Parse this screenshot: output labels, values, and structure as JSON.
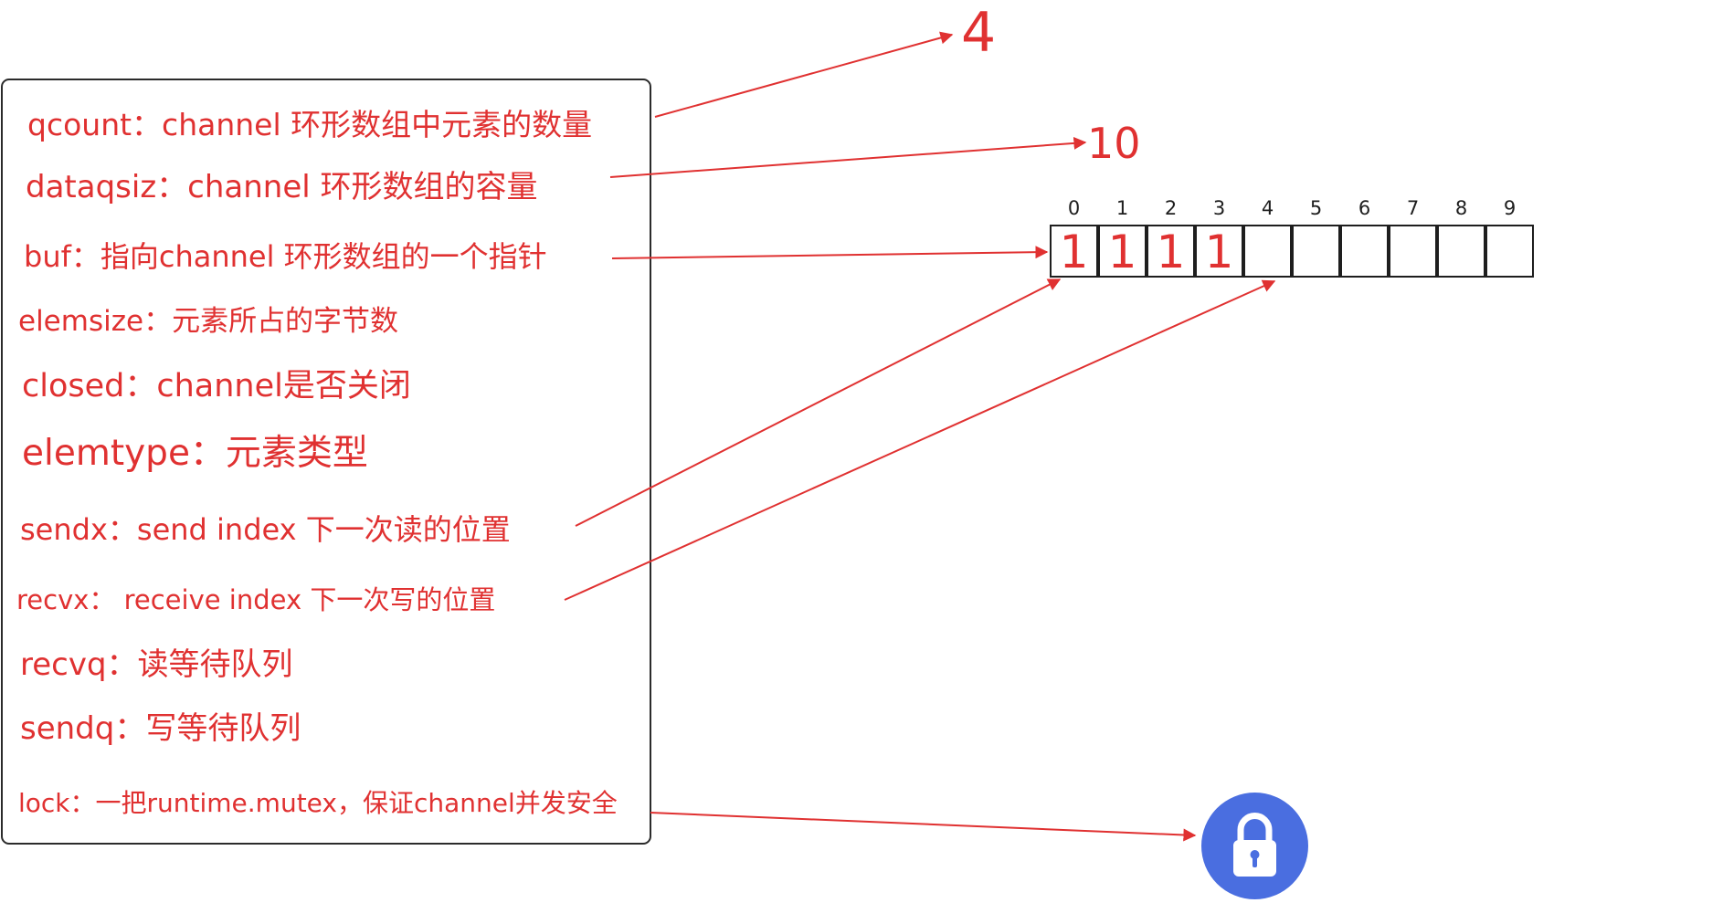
{
  "fields": [
    {
      "key": "qcount",
      "label": "qcount：channel 环形数组中元素的数量"
    },
    {
      "key": "dataqsiz",
      "label": "dataqsiz：channel 环形数组的容量"
    },
    {
      "key": "buf",
      "label": "buf：指向channel 环形数组的一个指针"
    },
    {
      "key": "elemsize",
      "label": "elemsize：元素所占的字节数"
    },
    {
      "key": "closed",
      "label": "closed：channel是否关闭"
    },
    {
      "key": "elemtype",
      "label": "elemtype：元素类型"
    },
    {
      "key": "sendx",
      "label": "sendx：send index 下一次读的位置"
    },
    {
      "key": "recvx",
      "label": "recvx：  receive index 下一次写的位置"
    },
    {
      "key": "recvq",
      "label": "recvq：读等待队列"
    },
    {
      "key": "sendq",
      "label": "sendq：写等待队列"
    },
    {
      "key": "lock",
      "label": "lock：一把runtime.mutex，保证channel并发安全"
    }
  ],
  "qcount_value": "4",
  "dataqsiz_value": "10",
  "buffer": {
    "indices": [
      "0",
      "1",
      "2",
      "3",
      "4",
      "5",
      "6",
      "7",
      "8",
      "9"
    ],
    "cells": [
      "1",
      "1",
      "1",
      "1",
      "",
      "",
      "",
      "",
      "",
      ""
    ]
  },
  "lock_icon": "padlock-icon",
  "colors": {
    "annotation": "#e03131",
    "outline": "#1e1e1e",
    "lock_badge": "#4a6ee0"
  }
}
